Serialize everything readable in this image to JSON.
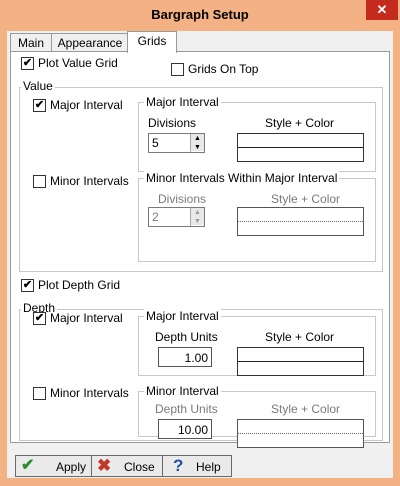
{
  "window": {
    "title": "Bargraph Setup",
    "close_glyph": "✕"
  },
  "tabs": [
    {
      "label": "Main"
    },
    {
      "label": "Appearance"
    },
    {
      "label": "Grids",
      "active": true
    }
  ],
  "value_section": {
    "plot_grid": {
      "label": "Plot Value Grid",
      "checked": true
    },
    "grids_on_top": {
      "label": "Grids On Top",
      "checked": false
    },
    "group_label": "Value",
    "major": {
      "checkbox_label": "Major Interval",
      "checked": true,
      "group_title": "Major Interval",
      "field_label": "Divisions",
      "value": "5",
      "style_label": "Style + Color"
    },
    "minor": {
      "checkbox_label": "Minor Intervals",
      "checked": false,
      "group_title": "Minor Intervals Within Major Interval",
      "field_label": "Divisions",
      "value": "2",
      "style_label": "Style + Color"
    }
  },
  "depth_section": {
    "plot_grid": {
      "label": "Plot Depth Grid",
      "checked": true
    },
    "group_label": "Depth",
    "major": {
      "checkbox_label": "Major Interval",
      "checked": true,
      "group_title": "Major Interval",
      "field_label": "Depth Units",
      "value": "1.00",
      "style_label": "Style + Color"
    },
    "minor": {
      "checkbox_label": "Minor Intervals",
      "checked": false,
      "group_title": "Minor Interval",
      "field_label": "Depth Units",
      "value": "10.00",
      "style_label": "Style + Color"
    }
  },
  "buttons": {
    "apply": {
      "label": "Apply",
      "icon": "checkmark-icon",
      "color": "#2e8b2e"
    },
    "close": {
      "label": "Close",
      "icon": "x-icon",
      "color": "#c0392b"
    },
    "help": {
      "label": "Help",
      "icon": "question-icon",
      "color": "#1f4fa8"
    }
  },
  "glyphs": {
    "check": "✔",
    "spin_up": "▲",
    "spin_down": "▼"
  },
  "colors": {
    "titlebar": "#f4b183",
    "close_button": "#c42b1c"
  }
}
